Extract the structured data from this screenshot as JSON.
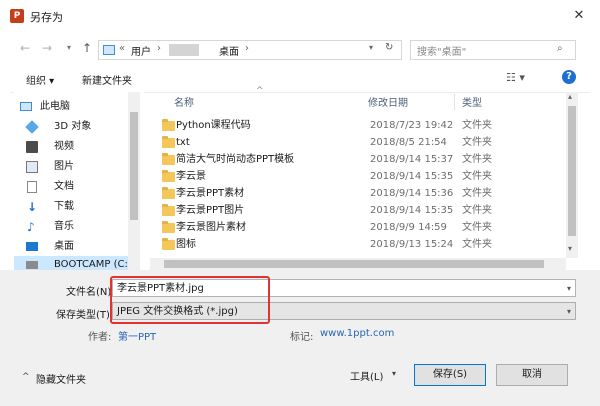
{
  "window": {
    "title": "另存为",
    "app_icon": "powerpoint-icon",
    "close_glyph": "✕"
  },
  "address": {
    "separator": "«",
    "crumbs": [
      "用户",
      "桌面"
    ],
    "arrow": "›"
  },
  "search": {
    "placeholder": "搜索\"桌面\""
  },
  "toolbar": {
    "organize_label": "组织 ▾",
    "new_folder_label": "新建文件夹"
  },
  "sidebar": {
    "items": [
      {
        "label": "此电脑",
        "icon": "computer-icon"
      },
      {
        "label": "3D 对象",
        "icon": "cube-icon"
      },
      {
        "label": "视频",
        "icon": "video-icon"
      },
      {
        "label": "图片",
        "icon": "picture-icon"
      },
      {
        "label": "文档",
        "icon": "document-icon"
      },
      {
        "label": "下载",
        "icon": "download-icon"
      },
      {
        "label": "音乐",
        "icon": "music-icon"
      },
      {
        "label": "桌面",
        "icon": "desktop-icon"
      },
      {
        "label": "BOOTCAMP (C:",
        "icon": "drive-icon"
      }
    ]
  },
  "files": {
    "headers": {
      "name": "名称",
      "date": "修改日期",
      "type": "类型"
    },
    "rows": [
      {
        "name": "Python课程代码",
        "date": "2018/7/23 19:42",
        "type": "文件夹"
      },
      {
        "name": "txt",
        "date": "2018/8/5 21:54",
        "type": "文件夹"
      },
      {
        "name": "简洁大气时尚动态PPT模板",
        "date": "2018/9/14 15:37",
        "type": "文件夹"
      },
      {
        "name": "李云景",
        "date": "2018/9/14 15:35",
        "type": "文件夹"
      },
      {
        "name": "李云景PPT素材",
        "date": "2018/9/14 15:36",
        "type": "文件夹"
      },
      {
        "name": "李云景PPT图片",
        "date": "2018/9/14 15:35",
        "type": "文件夹"
      },
      {
        "name": "李云景图片素材",
        "date": "2018/9/9 14:59",
        "type": "文件夹"
      },
      {
        "name": "图标",
        "date": "2018/9/13 15:24",
        "type": "文件夹"
      }
    ]
  },
  "form": {
    "filename_label": "文件名(N):",
    "filename_value": "李云景PPT素材.jpg",
    "type_label": "保存类型(T):",
    "type_value": "JPEG 文件交换格式 (*.jpg)",
    "author_label": "作者:",
    "author_value": "第一PPT",
    "tags_label": "标记:",
    "tags_value": "www.1ppt.com"
  },
  "footer": {
    "hide_folders_label": "隐藏文件夹",
    "tools_label": "工具(L)",
    "save_label": "保存(S)",
    "cancel_label": "取消"
  },
  "colors": {
    "highlight_box": "#e23333",
    "accent": "#0078d7",
    "folder": "#f3c75a"
  }
}
